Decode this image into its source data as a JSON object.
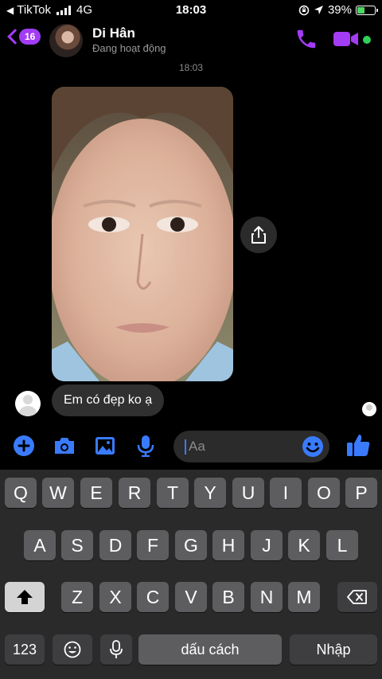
{
  "status_bar": {
    "carrier": "TikTok",
    "network": "4G",
    "time": "18:03",
    "battery": "39%",
    "battery_level": 0.39
  },
  "header": {
    "back_badge": "16",
    "contact_name": "Di Hân",
    "contact_status": "Đang hoạt động",
    "accent_color": "#a33cf5",
    "online_color": "#31d159"
  },
  "conversation": {
    "timestamp": "18:03",
    "messages": [
      {
        "type": "photo",
        "icon": "share-icon"
      },
      {
        "type": "text",
        "text": "Em có đẹp ko ạ"
      }
    ]
  },
  "composer": {
    "placeholder": "Aa",
    "icons": [
      "plus-icon",
      "camera-icon",
      "gallery-icon",
      "microphone-icon",
      "emoji-icon",
      "thumbs-up-icon"
    ]
  },
  "keyboard": {
    "row1": [
      "Q",
      "W",
      "E",
      "R",
      "T",
      "Y",
      "U",
      "I",
      "O",
      "P"
    ],
    "row2": [
      "A",
      "S",
      "D",
      "F",
      "G",
      "H",
      "J",
      "K",
      "L"
    ],
    "row3": [
      "Z",
      "X",
      "C",
      "V",
      "B",
      "N",
      "M"
    ],
    "numbers_key": "123",
    "space_label": "dấu cách",
    "return_label": "Nhập"
  }
}
